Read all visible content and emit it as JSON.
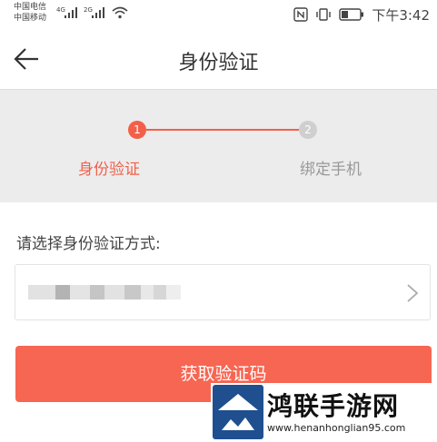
{
  "statusbar": {
    "carrier1": "中国电信",
    "carrier2": "中国移动",
    "net1": "4G",
    "net2": "2G",
    "time": "下午3:42"
  },
  "nav": {
    "title": "身份验证",
    "back_icon": "back-arrow-icon"
  },
  "steps": [
    {
      "number": "1",
      "label": "身份验证",
      "state": "active"
    },
    {
      "number": "2",
      "label": "绑定手机",
      "state": "inactive"
    }
  ],
  "form": {
    "prompt": "请选择身份验证方式:",
    "chevron_icon": "chevron-right-icon"
  },
  "button": {
    "label": "获取验证码"
  },
  "watermark": {
    "name": "鸿联手游网",
    "url": "www.henanhonglian95.com"
  },
  "colors": {
    "accent": "#f2604a",
    "button": "#f76652",
    "inactive": "#cfcfcf",
    "steps_bg": "#ececec"
  }
}
